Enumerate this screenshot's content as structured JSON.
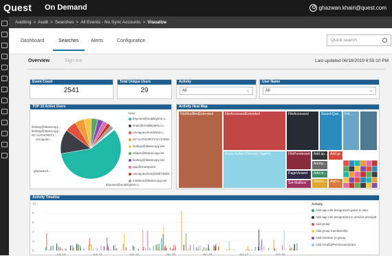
{
  "topbar": {
    "logo": "Quest",
    "product": "On Demand",
    "user": "ghazwan.khairi@quest.com"
  },
  "breadcrumb": {
    "items": [
      "Auditing",
      "Audit",
      "Searches",
      "All Events - No Sync Accounts"
    ],
    "current": "Visualize",
    "sep": ">"
  },
  "tabs": [
    "Dashboard",
    "Searches",
    "Alerts",
    "Configuration"
  ],
  "search": {
    "placeholder": "Quick search"
  },
  "subtabs": [
    "Overview",
    "Sign-ins"
  ],
  "last_updated": "Last updated 06/18/2019 6:55:10 PM",
  "cards": {
    "event_count": {
      "label": "Event Count",
      "value": "2541"
    },
    "unique_users": {
      "label": "Total Unique Users",
      "value": "29"
    },
    "activity": {
      "label": "Activity",
      "value": "All"
    },
    "user_name": {
      "label": "User Name",
      "value": "All"
    }
  },
  "top_users": {
    "title": "TOP 10 Active Users",
    "legend_title": "User",
    "legend": [
      {
        "name": "tthymen@mobilitytest.o...",
        "color": "#20b8a6"
      },
      {
        "name": "khairi@mobilitytest.co...",
        "color": "#3b3f45"
      },
      {
        "name": "umoajoevirton@test.c...",
        "color": "#e2523b"
      },
      {
        "name": "NT AUTHORITY\\SYSTEM",
        "color": "#f59a35"
      },
      {
        "name": "lindsay@titanscopy.net",
        "color": "#f4c542"
      },
      {
        "name": "ehilper@titanscopy.net",
        "color": "#5fa862"
      },
      {
        "name": "lindsay@titanscopy.net",
        "color": "#7c4fb0"
      },
      {
        "name": "app@sharepoint",
        "color": "#e36bae"
      },
      {
        "name": "umoajoevirton@26b74839...",
        "color": "#c0392b"
      },
      {
        "name": "mnitteon@titanscopy.net",
        "color": "#9e9e9e"
      }
    ],
    "pie_labels": [
      "lindsay@titanscopy...",
      "lindsay@titanscopy...",
      "NT AUTHORITY...",
      "umoajoen...",
      "ghazwan.k...",
      "tthymen@mobilitytest.o..."
    ]
  },
  "heatmap": {
    "title": "Activity Heat Map",
    "tiles": [
      "FileModifiedExtended",
      "FileAccessedExtended",
      "FileAccessed",
      "SearchQue...",
      "Fol...",
      "Azure Active Directory Sign-in",
      "FilePreviewed",
      "Add ap...",
      "Anony...",
      "Add m...",
      "Sharin...",
      "PageViewed",
      "Add s...",
      "Set-Mailbox",
      "Add gr..."
    ]
  },
  "timeline": {
    "title": "Activity Timeline",
    "x_ticks": [
      "Jun 12",
      "Jun 13",
      "Jun 14",
      "Jun 15",
      "Jun 16",
      "Jun 17",
      "Jun 18"
    ],
    "y_ticks": [
      "10",
      "8",
      "6",
      "4",
      "2",
      "0"
    ],
    "legend_title": "Activity",
    "legend": [
      {
        "name": "Add app role assignment grant to user",
        "color": "#2aa198"
      },
      {
        "name": "Add app role assignment to service principal",
        "color": "#333333"
      },
      {
        "name": "Add group",
        "color": "#e2523b"
      },
      {
        "name": "Add group membership",
        "color": "#f4c542"
      },
      {
        "name": "Add member to group",
        "color": "#7c4fb0"
      },
      {
        "name": "Add OAuth2PermissionGrant",
        "color": "#8ecae6"
      }
    ]
  }
}
